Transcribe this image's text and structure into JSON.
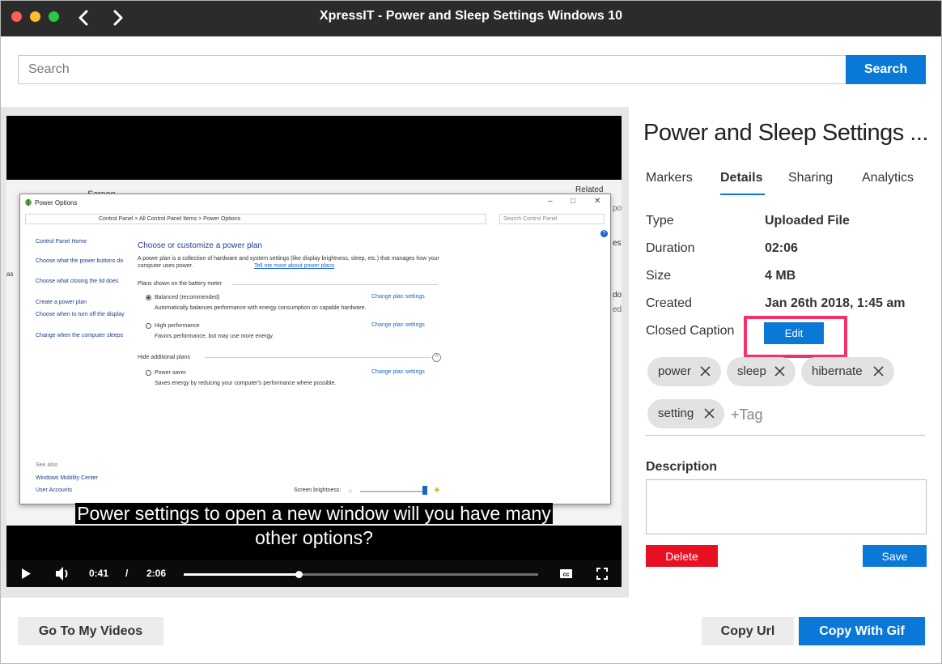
{
  "window": {
    "title": "XpressIT - Power and Sleep Settings Windows 10"
  },
  "search": {
    "placeholder": "Search",
    "button_label": "Search"
  },
  "video": {
    "screen": {
      "bg_text_1": "Screen",
      "bg_text_2": "Related settin",
      "bg_text_3": "po",
      "bg_text_4": "esti",
      "bg_text_5": "dow",
      "bg_text_6": "edb",
      "bg_text_7": "as",
      "window_title": "Power Options",
      "address": "Control Panel  >  All Control Panel Items  >  Power Options",
      "search_placeholder": "Search Control Panel",
      "sidebar": [
        "Control Panel Home",
        "Choose what the power buttons do",
        "Choose what closing the lid does",
        "Create a power plan",
        "Choose when to turn off the display",
        "Change when the computer sleeps"
      ],
      "see_also": "See also",
      "see_also_items": [
        "Windows Mobility Center",
        "User Accounts"
      ],
      "heading": "Choose or customize a power plan",
      "intro": "A power plan is a collection of hardware and system settings (like display brightness, sleep, etc.) that manages how your computer uses power.",
      "intro_link": "Tell me more about power plans",
      "plans_label": "Plans shown on the battery meter",
      "plans": [
        {
          "name": "Balanced (recommended)",
          "desc": "Automatically balances performance with energy consumption on capable hardware.",
          "link": "Change plan settings",
          "selected": true
        },
        {
          "name": "High performance",
          "desc": "Favors performance, but may use more energy.",
          "link": "Change plan settings",
          "selected": false
        }
      ],
      "hidden_label": "Hide additional plans",
      "hidden_plans": [
        {
          "name": "Power saver",
          "desc": "Saves energy by reducing your computer's performance where possible.",
          "link": "Change plan settings",
          "selected": false
        }
      ],
      "brightness_label": "Screen brightness:"
    },
    "caption_line1": "Power settings to open a new window will you have many",
    "caption_line2": "other options?",
    "current_time": "0:41",
    "time_separator": "/",
    "duration": "2:06",
    "progress_fraction": 0.325
  },
  "details": {
    "title": "Power and Sleep Settings ...",
    "tabs": [
      "Markers",
      "Details",
      "Sharing",
      "Analytics"
    ],
    "active_tab": "Details",
    "fields": [
      {
        "label": "Type",
        "value": "Uploaded File"
      },
      {
        "label": "Duration",
        "value": "02:06"
      },
      {
        "label": "Size",
        "value": "4 MB"
      },
      {
        "label": "Created",
        "value": "Jan 26th 2018, 1:45 am"
      }
    ],
    "closed_caption_label": "Closed Caption",
    "edit_label": "Edit",
    "tags": [
      "power",
      "sleep",
      "hibernate",
      "setting"
    ],
    "tag_placeholder": "+Tag",
    "description_label": "Description",
    "description_value": "",
    "delete_label": "Delete",
    "save_label": "Save"
  },
  "footer": {
    "my_videos_label": "Go To My Videos",
    "copy_url_label": "Copy Url",
    "copy_gif_label": "Copy With Gif"
  },
  "colors": {
    "accent": "#0a78d7",
    "danger": "#e81123",
    "highlight": "#f5306e",
    "titlebar": "#2b2b2b"
  }
}
